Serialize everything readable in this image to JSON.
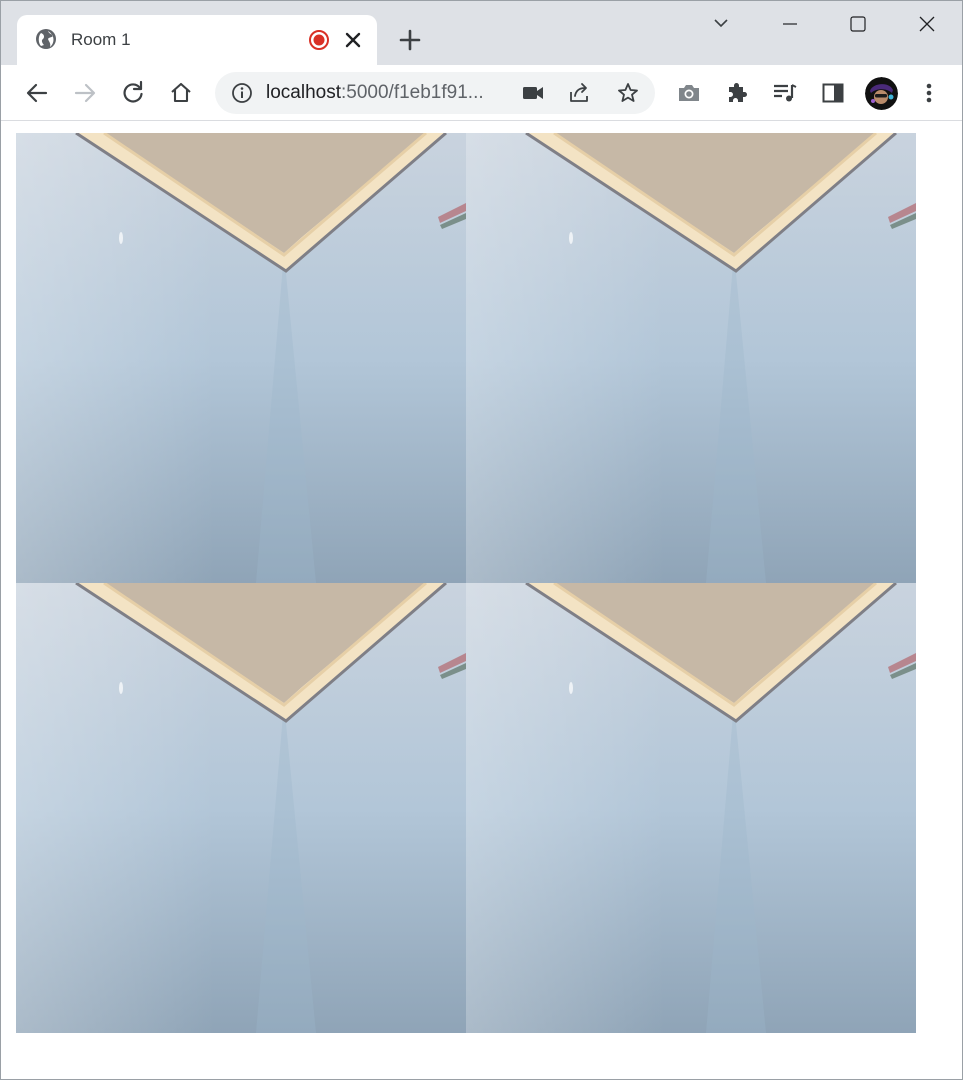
{
  "tab": {
    "title": "Room 1",
    "favicon": "globe-icon",
    "recording_indicator": "recording-dot-icon",
    "close": "close-icon"
  },
  "tabstrip": {
    "new_tab": "plus-icon",
    "tab_search": "chevron-down-icon"
  },
  "window_controls": [
    "minimize-icon",
    "maximize-icon",
    "close-icon"
  ],
  "toolbar": {
    "back": "arrow-left-icon",
    "forward": "arrow-right-icon",
    "reload": "reload-icon",
    "home": "home-icon"
  },
  "omnibox": {
    "site_info": "info-circle-icon",
    "url_host": "localhost",
    "url_rest": ":5000/f1eb1f91...",
    "camera_indicator": "video-camera-icon",
    "share": "share-icon",
    "bookmark": "star-icon"
  },
  "extensions": [
    "camera-icon",
    "puzzle-icon",
    "media-control-icon",
    "side-panel-icon"
  ],
  "profile": {
    "avatar": "avatar"
  },
  "menu": "kebab-menu-icon",
  "video_grid": {
    "tiles": [
      {
        "id": "video-1",
        "content": "webcam-ceiling-corner"
      },
      {
        "id": "video-2",
        "content": "webcam-ceiling-corner"
      },
      {
        "id": "video-3",
        "content": "webcam-ceiling-corner"
      },
      {
        "id": "video-4",
        "content": "webcam-ceiling-corner"
      }
    ]
  },
  "colors": {
    "tabstrip_bg": "#dee1e6",
    "recording_red": "#d93025",
    "wall_blue": "#a9bfd3",
    "ceiling": "#c9bba8",
    "molding": "#f3e3c4"
  }
}
